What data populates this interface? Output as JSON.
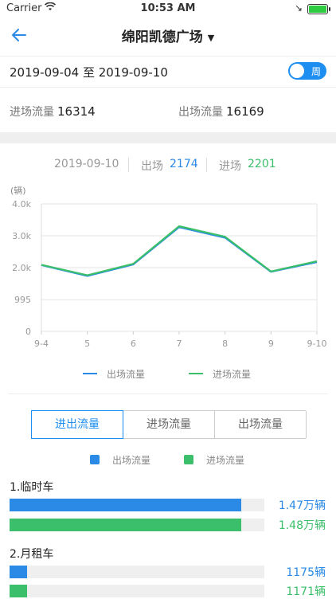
{
  "status": {
    "carrier": "Carrier",
    "time": "10:53 AM"
  },
  "nav": {
    "title": "绵阳凯德广场"
  },
  "date_range": "2019-09-04 至 2019-09-10",
  "toggle_label": "周",
  "flow": {
    "in_label": "进场流量",
    "in_value": "16314",
    "out_label": "出场流量",
    "out_value": "16169"
  },
  "summary": {
    "date": "2019-09-10",
    "out_label": "出场",
    "out_value": "2174",
    "in_label": "进场",
    "in_value": "2201"
  },
  "colors": {
    "out": "#2a8ae6",
    "in": "#3bbf6a",
    "accent": "#1e8ef0"
  },
  "chart_data": {
    "type": "line",
    "unit_label": "(辆)",
    "categories": [
      "9-4",
      "5",
      "6",
      "7",
      "8",
      "9",
      "9-10"
    ],
    "ytick_labels": [
      "0",
      "995",
      "2.0k",
      "3.0k",
      "4.0k"
    ],
    "yticks": [
      0,
      995,
      2000,
      3000,
      4000
    ],
    "ylim": [
      0,
      4000
    ],
    "series": [
      {
        "name": "出场流量",
        "values": [
          2080,
          1740,
          2100,
          3270,
          2940,
          1870,
          2174
        ]
      },
      {
        "name": "进场流量",
        "values": [
          2090,
          1760,
          2120,
          3300,
          2970,
          1880,
          2201
        ]
      }
    ],
    "legend": [
      "出场流量",
      "进场流量"
    ]
  },
  "tabs": [
    "进出流量",
    "进场流量",
    "出场流量"
  ],
  "legend2": [
    "出场流量",
    "进场流量"
  ],
  "groups": [
    {
      "title": "1.临时车",
      "out_label": "1.47万辆",
      "out_fraction": 0.91,
      "in_label": "1.48万辆",
      "in_fraction": 0.91
    },
    {
      "title": "2.月租车",
      "out_label": "1175辆",
      "out_fraction": 0.07,
      "in_label": "1171辆",
      "in_fraction": 0.07
    }
  ]
}
